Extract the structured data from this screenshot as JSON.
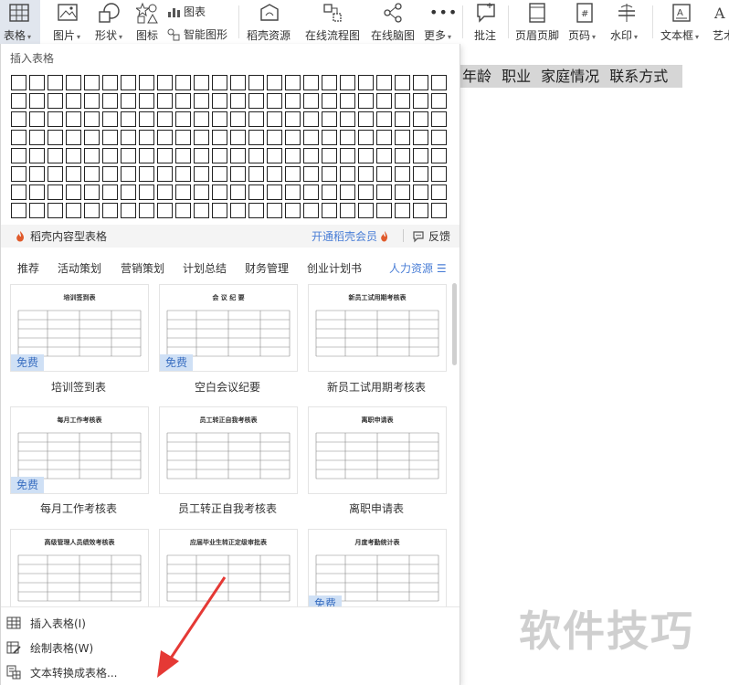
{
  "ribbon": {
    "table": "表格",
    "picture": "图片",
    "shape": "形状",
    "icon": "图标",
    "chart": "图表",
    "smart_shape": "智能图形",
    "docer_resources": "稻壳资源",
    "online_flowchart": "在线流程图",
    "online_mindmap": "在线脑图",
    "more": "更多",
    "comment": "批注",
    "header_footer": "页眉页脚",
    "page_number": "页码",
    "watermark": "水印",
    "textbox": "文本框",
    "wordart": "艺术"
  },
  "document": {
    "selected_line": "年龄 职业 家庭情况 联系方式",
    "watermark_text": "软件技巧"
  },
  "panel": {
    "title": "插入表格",
    "grid": {
      "columns": 24,
      "rows": 8
    },
    "promo_left": "稻壳内容型表格",
    "promo_right": "开通稻壳会员",
    "feedback": "反馈",
    "categories": [
      "推荐",
      "活动策划",
      "营销策划",
      "计划总结",
      "财务管理",
      "创业计划书",
      "人力资源"
    ],
    "selected_category": "人力资源",
    "free_badge": "免费",
    "templates": [
      {
        "name": "培训签到表",
        "heading": "培训签到表",
        "free": true
      },
      {
        "name": "空白会议纪要",
        "heading": "会 议 纪 要",
        "free": true
      },
      {
        "name": "新员工试用期考核表",
        "heading": "新员工试用期考核表",
        "free": false
      },
      {
        "name": "每月工作考核表",
        "heading": "每月工作考核表",
        "free": true
      },
      {
        "name": "员工转正自我考核表",
        "heading": "员工转正自我考核表",
        "free": false
      },
      {
        "name": "离职申请表",
        "heading": "离职申请表",
        "free": false
      },
      {
        "name": "",
        "heading": "高级管理人员绩效考核表",
        "free": false
      },
      {
        "name": "",
        "heading": "应届毕业生转正定级审批表",
        "free": false
      },
      {
        "name": "",
        "heading": "月度考勤统计表",
        "free": true
      }
    ],
    "bottom_items": [
      "插入表格(I)",
      "绘制表格(W)",
      "文本转换成表格..."
    ]
  },
  "colors": {
    "accent": "#4a7ed6",
    "arrow": "#e53935",
    "free_bg": "#cfe0f5"
  }
}
